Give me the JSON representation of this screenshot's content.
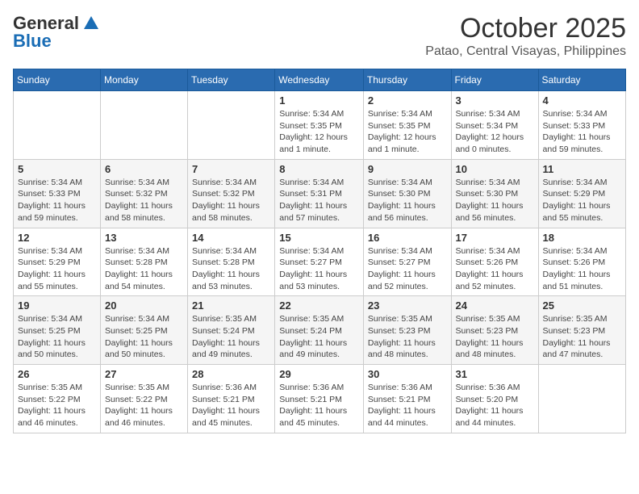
{
  "header": {
    "logo_general": "General",
    "logo_blue": "Blue",
    "month_title": "October 2025",
    "location": "Patao, Central Visayas, Philippines"
  },
  "days_of_week": [
    "Sunday",
    "Monday",
    "Tuesday",
    "Wednesday",
    "Thursday",
    "Friday",
    "Saturday"
  ],
  "weeks": [
    [
      {
        "day": "",
        "info": ""
      },
      {
        "day": "",
        "info": ""
      },
      {
        "day": "",
        "info": ""
      },
      {
        "day": "1",
        "info": "Sunrise: 5:34 AM\nSunset: 5:35 PM\nDaylight: 12 hours\nand 1 minute."
      },
      {
        "day": "2",
        "info": "Sunrise: 5:34 AM\nSunset: 5:35 PM\nDaylight: 12 hours\nand 1 minute."
      },
      {
        "day": "3",
        "info": "Sunrise: 5:34 AM\nSunset: 5:34 PM\nDaylight: 12 hours\nand 0 minutes."
      },
      {
        "day": "4",
        "info": "Sunrise: 5:34 AM\nSunset: 5:33 PM\nDaylight: 11 hours\nand 59 minutes."
      }
    ],
    [
      {
        "day": "5",
        "info": "Sunrise: 5:34 AM\nSunset: 5:33 PM\nDaylight: 11 hours\nand 59 minutes."
      },
      {
        "day": "6",
        "info": "Sunrise: 5:34 AM\nSunset: 5:32 PM\nDaylight: 11 hours\nand 58 minutes."
      },
      {
        "day": "7",
        "info": "Sunrise: 5:34 AM\nSunset: 5:32 PM\nDaylight: 11 hours\nand 58 minutes."
      },
      {
        "day": "8",
        "info": "Sunrise: 5:34 AM\nSunset: 5:31 PM\nDaylight: 11 hours\nand 57 minutes."
      },
      {
        "day": "9",
        "info": "Sunrise: 5:34 AM\nSunset: 5:30 PM\nDaylight: 11 hours\nand 56 minutes."
      },
      {
        "day": "10",
        "info": "Sunrise: 5:34 AM\nSunset: 5:30 PM\nDaylight: 11 hours\nand 56 minutes."
      },
      {
        "day": "11",
        "info": "Sunrise: 5:34 AM\nSunset: 5:29 PM\nDaylight: 11 hours\nand 55 minutes."
      }
    ],
    [
      {
        "day": "12",
        "info": "Sunrise: 5:34 AM\nSunset: 5:29 PM\nDaylight: 11 hours\nand 55 minutes."
      },
      {
        "day": "13",
        "info": "Sunrise: 5:34 AM\nSunset: 5:28 PM\nDaylight: 11 hours\nand 54 minutes."
      },
      {
        "day": "14",
        "info": "Sunrise: 5:34 AM\nSunset: 5:28 PM\nDaylight: 11 hours\nand 53 minutes."
      },
      {
        "day": "15",
        "info": "Sunrise: 5:34 AM\nSunset: 5:27 PM\nDaylight: 11 hours\nand 53 minutes."
      },
      {
        "day": "16",
        "info": "Sunrise: 5:34 AM\nSunset: 5:27 PM\nDaylight: 11 hours\nand 52 minutes."
      },
      {
        "day": "17",
        "info": "Sunrise: 5:34 AM\nSunset: 5:26 PM\nDaylight: 11 hours\nand 52 minutes."
      },
      {
        "day": "18",
        "info": "Sunrise: 5:34 AM\nSunset: 5:26 PM\nDaylight: 11 hours\nand 51 minutes."
      }
    ],
    [
      {
        "day": "19",
        "info": "Sunrise: 5:34 AM\nSunset: 5:25 PM\nDaylight: 11 hours\nand 50 minutes."
      },
      {
        "day": "20",
        "info": "Sunrise: 5:34 AM\nSunset: 5:25 PM\nDaylight: 11 hours\nand 50 minutes."
      },
      {
        "day": "21",
        "info": "Sunrise: 5:35 AM\nSunset: 5:24 PM\nDaylight: 11 hours\nand 49 minutes."
      },
      {
        "day": "22",
        "info": "Sunrise: 5:35 AM\nSunset: 5:24 PM\nDaylight: 11 hours\nand 49 minutes."
      },
      {
        "day": "23",
        "info": "Sunrise: 5:35 AM\nSunset: 5:23 PM\nDaylight: 11 hours\nand 48 minutes."
      },
      {
        "day": "24",
        "info": "Sunrise: 5:35 AM\nSunset: 5:23 PM\nDaylight: 11 hours\nand 48 minutes."
      },
      {
        "day": "25",
        "info": "Sunrise: 5:35 AM\nSunset: 5:23 PM\nDaylight: 11 hours\nand 47 minutes."
      }
    ],
    [
      {
        "day": "26",
        "info": "Sunrise: 5:35 AM\nSunset: 5:22 PM\nDaylight: 11 hours\nand 46 minutes."
      },
      {
        "day": "27",
        "info": "Sunrise: 5:35 AM\nSunset: 5:22 PM\nDaylight: 11 hours\nand 46 minutes."
      },
      {
        "day": "28",
        "info": "Sunrise: 5:36 AM\nSunset: 5:21 PM\nDaylight: 11 hours\nand 45 minutes."
      },
      {
        "day": "29",
        "info": "Sunrise: 5:36 AM\nSunset: 5:21 PM\nDaylight: 11 hours\nand 45 minutes."
      },
      {
        "day": "30",
        "info": "Sunrise: 5:36 AM\nSunset: 5:21 PM\nDaylight: 11 hours\nand 44 minutes."
      },
      {
        "day": "31",
        "info": "Sunrise: 5:36 AM\nSunset: 5:20 PM\nDaylight: 11 hours\nand 44 minutes."
      },
      {
        "day": "",
        "info": ""
      }
    ]
  ]
}
